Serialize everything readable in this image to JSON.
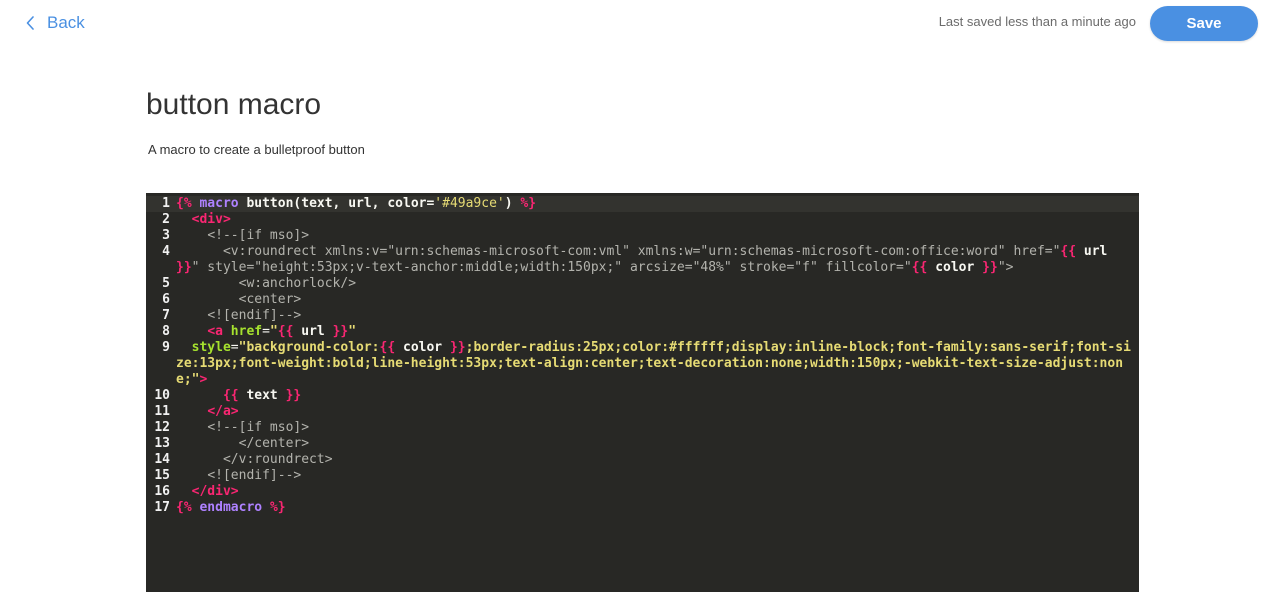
{
  "colors": {
    "accent": "#4a90e2"
  },
  "header": {
    "back_label": "Back",
    "back_icon": "chevron-left-icon",
    "status": "Last saved less than a minute ago",
    "save_label": "Save"
  },
  "macro": {
    "title": "button macro",
    "description": "A macro to create a bulletproof button"
  },
  "editor": {
    "language": "html+nunjucks",
    "active_line": 1,
    "lines": [
      [
        [
          "delim",
          "{%"
        ],
        [
          "plain",
          " "
        ],
        [
          "kw",
          "macro"
        ],
        [
          "plain",
          " "
        ],
        [
          "id",
          "button(text, url, color="
        ],
        [
          "str",
          "'#49a9ce'"
        ],
        [
          "id",
          ")"
        ],
        [
          "plain",
          " "
        ],
        [
          "delim",
          "%}"
        ]
      ],
      [
        [
          "plain",
          "  "
        ],
        [
          "tag",
          "<div>"
        ]
      ],
      [
        [
          "plain",
          "    "
        ],
        [
          "com",
          "<!--[if mso]>"
        ]
      ],
      [
        [
          "plain",
          "      "
        ],
        [
          "com",
          "<v:roundrect xmlns:v=\"urn:schemas-microsoft-com:vml\" xmlns:w=\"urn:schemas-microsoft-com:office:word\" href=\""
        ],
        [
          "delim",
          "{{"
        ],
        [
          "plain",
          " "
        ],
        [
          "id",
          "url"
        ],
        [
          "plain",
          " "
        ],
        [
          "delim",
          "}}"
        ],
        [
          "com",
          "\" style=\"height:53px;v-text-anchor:middle;width:150px;\" arcsize=\"48%\" stroke=\"f\" fillcolor=\""
        ],
        [
          "delim",
          "{{"
        ],
        [
          "plain",
          " "
        ],
        [
          "id",
          "color"
        ],
        [
          "plain",
          " "
        ],
        [
          "delim",
          "}}"
        ],
        [
          "com",
          "\">"
        ]
      ],
      [
        [
          "plain",
          "        "
        ],
        [
          "com",
          "<w:anchorlock/>"
        ]
      ],
      [
        [
          "plain",
          "        "
        ],
        [
          "com",
          "<center>"
        ]
      ],
      [
        [
          "plain",
          "    "
        ],
        [
          "com",
          "<![endif]-->"
        ]
      ],
      [
        [
          "plain",
          "    "
        ],
        [
          "tag",
          "<a"
        ],
        [
          "plain",
          " "
        ],
        [
          "attr",
          "href"
        ],
        [
          "plain",
          "="
        ],
        [
          "sv",
          "\""
        ],
        [
          "delim",
          "{{"
        ],
        [
          "plain",
          " "
        ],
        [
          "id",
          "url"
        ],
        [
          "plain",
          " "
        ],
        [
          "delim",
          "}}"
        ],
        [
          "sv",
          "\""
        ]
      ],
      [
        [
          "plain",
          "  "
        ],
        [
          "attr",
          "style"
        ],
        [
          "plain",
          "="
        ],
        [
          "sv",
          "\"background-color:"
        ],
        [
          "delim",
          "{{"
        ],
        [
          "plain",
          " "
        ],
        [
          "id",
          "color"
        ],
        [
          "plain",
          " "
        ],
        [
          "delim",
          "}}"
        ],
        [
          "sv",
          ";border-radius:25px;color:#ffffff;display:inline-block;font-family:sans-serif;font-size:13px;font-weight:bold;line-height:53px;text-align:center;text-decoration:none;width:150px;-webkit-text-size-adjust:none;\""
        ],
        [
          "tag",
          ">"
        ]
      ],
      [
        [
          "plain",
          "      "
        ],
        [
          "delim",
          "{{"
        ],
        [
          "plain",
          " "
        ],
        [
          "id",
          "text"
        ],
        [
          "plain",
          " "
        ],
        [
          "delim",
          "}}"
        ]
      ],
      [
        [
          "plain",
          "    "
        ],
        [
          "tag",
          "</a>"
        ]
      ],
      [
        [
          "plain",
          "    "
        ],
        [
          "com",
          "<!--[if mso]>"
        ]
      ],
      [
        [
          "plain",
          "        "
        ],
        [
          "com",
          "</center>"
        ]
      ],
      [
        [
          "plain",
          "      "
        ],
        [
          "com",
          "</v:roundrect>"
        ]
      ],
      [
        [
          "plain",
          "    "
        ],
        [
          "com",
          "<![endif]-->"
        ]
      ],
      [
        [
          "plain",
          "  "
        ],
        [
          "tag",
          "</div>"
        ]
      ],
      [
        [
          "delim",
          "{%"
        ],
        [
          "plain",
          " "
        ],
        [
          "kw",
          "endmacro"
        ],
        [
          "plain",
          " "
        ],
        [
          "delim",
          "%}"
        ]
      ]
    ]
  }
}
